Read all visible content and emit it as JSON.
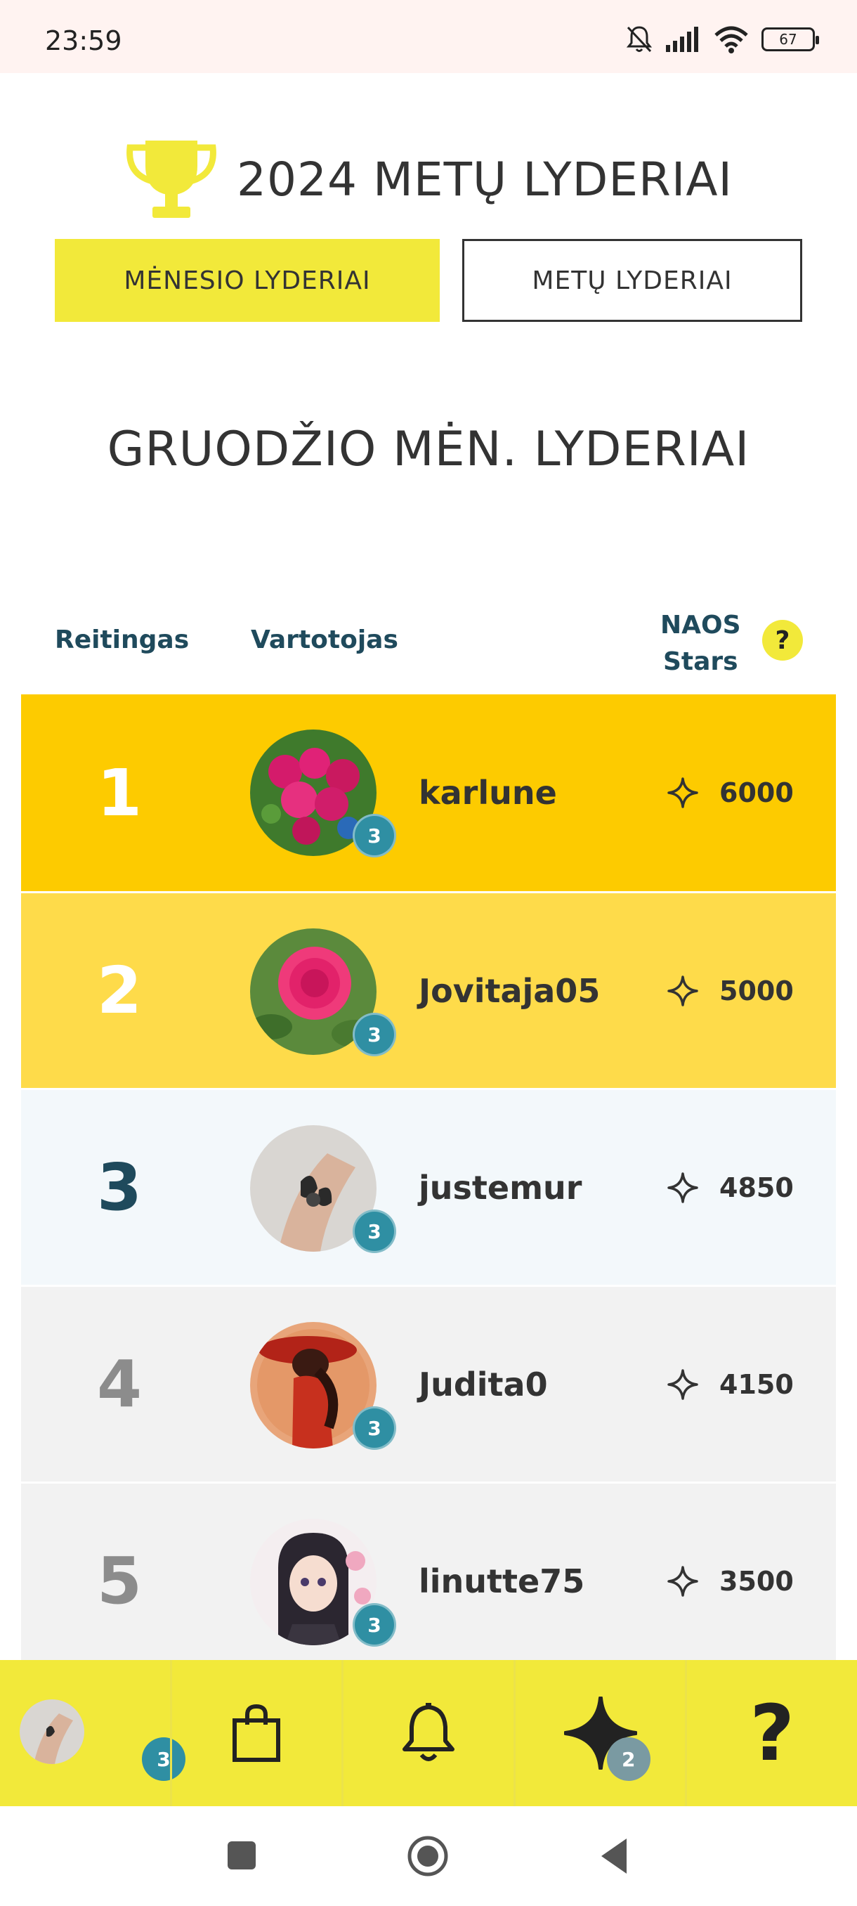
{
  "status": {
    "time": "23:59",
    "battery": "67"
  },
  "header": {
    "title": "2024 METŲ LYDERIAI",
    "tabs": [
      "MĖNESIO LYDERIAI",
      "METŲ LYDERIAI"
    ],
    "active_tab": "MĖNESIO LYDERIAI"
  },
  "section_title": "GRUODŽIO MĖN. LYDERIAI",
  "table": {
    "col_rank": "Reitingas",
    "col_user": "Vartotojas",
    "col_stars_line1": "NAOS",
    "col_stars_line2": "Stars",
    "help": "?",
    "rows": [
      {
        "rank": "1",
        "user": "karlune",
        "stars": "6000",
        "level": "3"
      },
      {
        "rank": "2",
        "user": "Jovitaja05",
        "stars": "5000",
        "level": "3"
      },
      {
        "rank": "3",
        "user": "justemur",
        "stars": "4850",
        "level": "3"
      },
      {
        "rank": "4",
        "user": "Judita0",
        "stars": "4150",
        "level": "3"
      },
      {
        "rank": "5",
        "user": "linutte75",
        "stars": "3500",
        "level": "3"
      }
    ]
  },
  "bottom_nav": {
    "profile_badge": "3",
    "stars_badge": "2",
    "help_label": "?"
  },
  "colors": {
    "brand_yellow": "#f2e93a",
    "gold": "#fdcb00",
    "light_gold": "#fedb4a",
    "badge_teal": "#2f8fa3"
  }
}
